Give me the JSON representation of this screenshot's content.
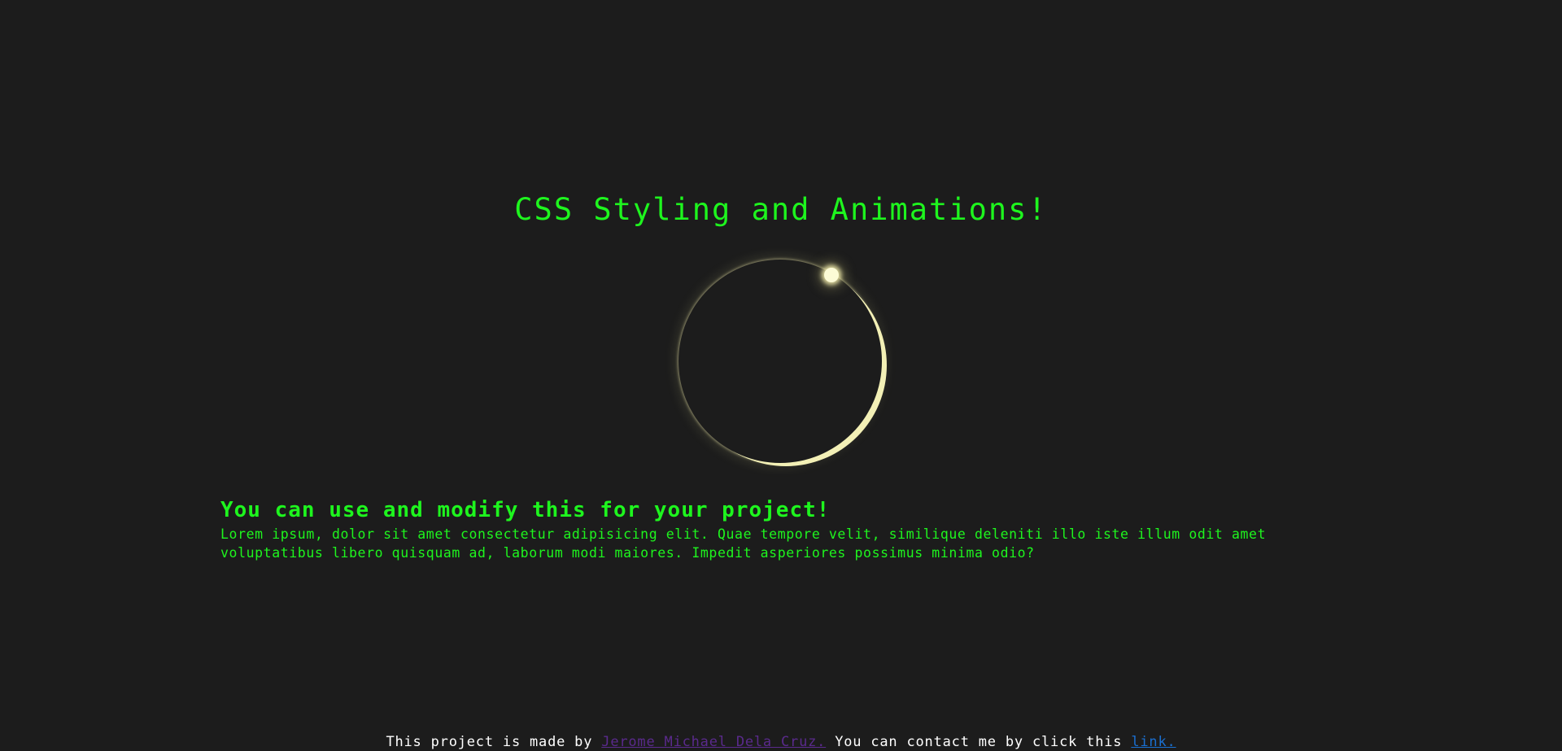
{
  "title": "CSS Styling and Animations!",
  "section": {
    "heading": "You can use and modify this for your project!",
    "body": "Lorem ipsum, dolor sit amet consectetur adipisicing elit. Quae tempore velit, similique deleniti illo iste illum odit amet voluptatibus libero quisquam ad, laborum modi maiores. Impedit asperiores possimus minima odio?"
  },
  "footer": {
    "prefix": "This project is made by ",
    "author_link": "Jerome Michael Dela Cruz.",
    "middle": " You can contact me by click this ",
    "contact_link": "link."
  },
  "colors": {
    "background": "#1c1c1c",
    "accent_green": "#1ef51e",
    "eclipse_glow": "#f3f0b6",
    "author_link": "#5a2a8c",
    "contact_link": "#1a6fd0"
  }
}
